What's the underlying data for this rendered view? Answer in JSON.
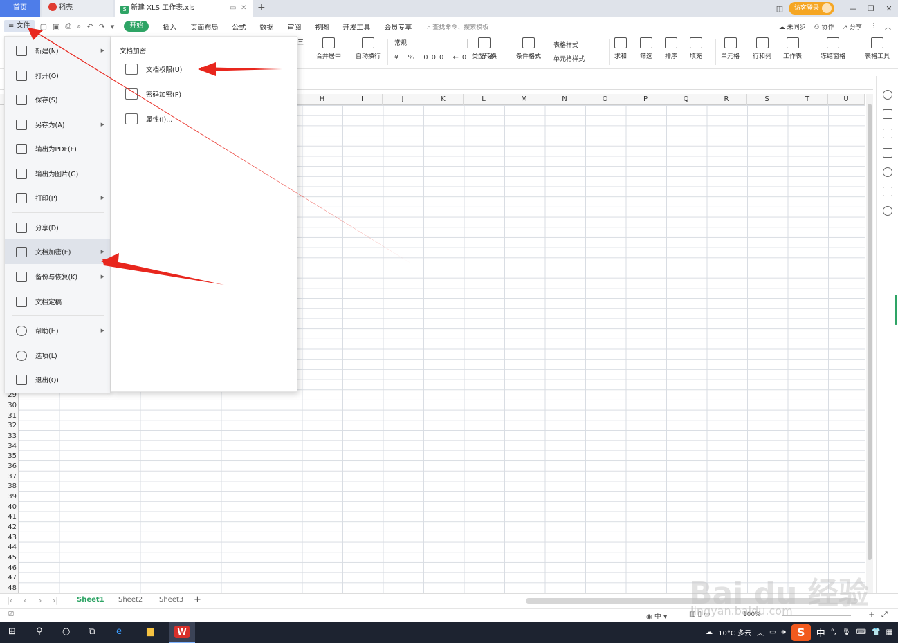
{
  "tabbar": {
    "home_tab": "首页",
    "daoke_tab": "稻壳",
    "doc_tab": "新建 XLS 工作表.xls",
    "doc_icon": "S",
    "login_btn": "访客登录"
  },
  "menubar": {
    "file_btn": "文件",
    "tabs": [
      "开始",
      "插入",
      "页面布局",
      "公式",
      "数据",
      "审阅",
      "视图",
      "开发工具",
      "会员专享"
    ],
    "search": "查找命令、搜索模板",
    "right": [
      "未同步",
      "协作",
      "分享"
    ]
  },
  "ribbon": {
    "merge": "合并居中",
    "autowrap": "自动换行",
    "num_format": "常规",
    "num_symbols": "¥ % 000 ←0 .00",
    "type_convert": "类型转换",
    "cond_format": "条件格式",
    "table_style": "表格样式",
    "cell_style": "单元格样式",
    "sum": "求和",
    "filter": "筛选",
    "sort": "排序",
    "fill": "填充",
    "cell": "单元格",
    "row_col": "行和列",
    "worksheet": "工作表",
    "freeze": "冻结窗格",
    "table_tools": "表格工具",
    "left_label": "三"
  },
  "grid": {
    "columns": [
      "H",
      "I",
      "J",
      "K",
      "L",
      "M",
      "N",
      "O",
      "P",
      "Q",
      "R",
      "S",
      "T",
      "U"
    ],
    "rows": [
      "29",
      "30",
      "31",
      "32",
      "33",
      "34",
      "35",
      "36",
      "37",
      "38",
      "39",
      "40",
      "41",
      "42",
      "43",
      "44",
      "45",
      "46",
      "47",
      "48"
    ]
  },
  "sheets": [
    "Sheet1",
    "Sheet2",
    "Sheet3"
  ],
  "status": {
    "zoom": "100%"
  },
  "file_menu": {
    "items": [
      {
        "label": "新建(N)",
        "icon": "new-doc-icon",
        "arrow": true
      },
      {
        "label": "打开(O)",
        "icon": "folder-open-icon",
        "arrow": false
      },
      {
        "label": "保存(S)",
        "icon": "save-icon",
        "arrow": false
      },
      {
        "label": "另存为(A)",
        "icon": "save-as-icon",
        "arrow": true
      },
      {
        "label": "输出为PDF(F)",
        "icon": "pdf-icon",
        "arrow": false
      },
      {
        "label": "输出为图片(G)",
        "icon": "image-icon",
        "arrow": false
      },
      {
        "label": "打印(P)",
        "icon": "print-icon",
        "arrow": true
      },
      {
        "label": "分享(D)",
        "icon": "share-icon",
        "arrow": false
      },
      {
        "label": "文档加密(E)",
        "icon": "encrypt-icon",
        "arrow": true
      },
      {
        "label": "备份与恢复(K)",
        "icon": "backup-icon",
        "arrow": true
      },
      {
        "label": "文档定稿",
        "icon": "finalize-icon",
        "arrow": false
      },
      {
        "label": "帮助(H)",
        "icon": "help-icon",
        "arrow": true
      },
      {
        "label": "选项(L)",
        "icon": "settings-icon",
        "arrow": false
      },
      {
        "label": "退出(Q)",
        "icon": "exit-icon",
        "arrow": false
      }
    ]
  },
  "submenu": {
    "title": "文档加密",
    "items": [
      "文档权限(U)",
      "密码加密(P)",
      "属性(I)..."
    ]
  },
  "taskbar": {
    "weather": "10°C 多云",
    "ime_lang": "中",
    "ime_icon": "S"
  },
  "watermark": {
    "text": "Bai du 经验",
    "url": "jingyan.baidu.com"
  },
  "colors": {
    "accent_green": "#2ea465",
    "arrow_red": "#e8261d",
    "home_tab_blue": "#4e7de9"
  }
}
